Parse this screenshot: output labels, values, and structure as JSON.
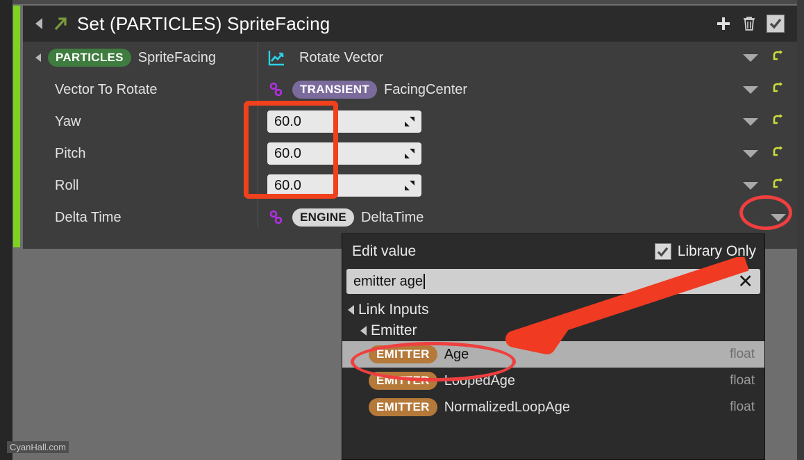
{
  "node": {
    "title": "Set (PARTICLES) SpriteFacing",
    "header_actions": [
      {
        "name": "add-button",
        "icon": "plus-icon"
      },
      {
        "name": "delete-button",
        "icon": "trash-icon"
      },
      {
        "name": "enable-checkbox",
        "icon": "check-icon",
        "checked": true
      }
    ],
    "rows": [
      {
        "label": "SpriteFacing",
        "badge": "PARTICLES",
        "badge_kind": "particles",
        "value_icon": "line-chart-icon",
        "value": "Rotate Vector",
        "kind": "module",
        "has_caret": true,
        "has_reset": true
      },
      {
        "label": "Vector To Rotate",
        "badge": "TRANSIENT",
        "badge_kind": "transient",
        "value": "FacingCenter",
        "kind": "link",
        "has_reset": true
      },
      {
        "label": "Yaw",
        "value": "60.0",
        "kind": "number",
        "has_reset": true
      },
      {
        "label": "Pitch",
        "value": "60.0",
        "kind": "number",
        "has_reset": true
      },
      {
        "label": "Roll",
        "value": "60.0",
        "kind": "number",
        "has_reset": true
      },
      {
        "label": "Delta Time",
        "badge": "ENGINE",
        "badge_kind": "engine",
        "value": "DeltaTime",
        "kind": "link",
        "has_reset": false
      }
    ]
  },
  "popup": {
    "title": "Edit value",
    "library_only_label": "Library Only",
    "library_only_checked": true,
    "search_value": "emitter age",
    "search_placeholder": "Search",
    "clear_icon": "close-icon",
    "tree": [
      {
        "level": 1,
        "label": "Link Inputs"
      },
      {
        "level": 2,
        "label": "Emitter"
      }
    ],
    "items": [
      {
        "badge": "EMITTER",
        "name": "Age",
        "type": "float",
        "selected": true
      },
      {
        "badge": "EMITTER",
        "name": "LoopedAge",
        "type": "float",
        "selected": false
      },
      {
        "badge": "EMITTER",
        "name": "NormalizedLoopAge",
        "type": "float",
        "selected": false
      }
    ]
  },
  "watermark": "CyanHall.com",
  "colors": {
    "accent_green": "#7ed321",
    "annotation_red": "#f0411c",
    "badge_particles": "#3f7c3f",
    "badge_transient": "#7a6b9c",
    "badge_engine": "#d8d8d8",
    "badge_emitter": "#b5793a",
    "reset_arrow": "#cddc39",
    "chart_icon": "#2ad2e8"
  }
}
